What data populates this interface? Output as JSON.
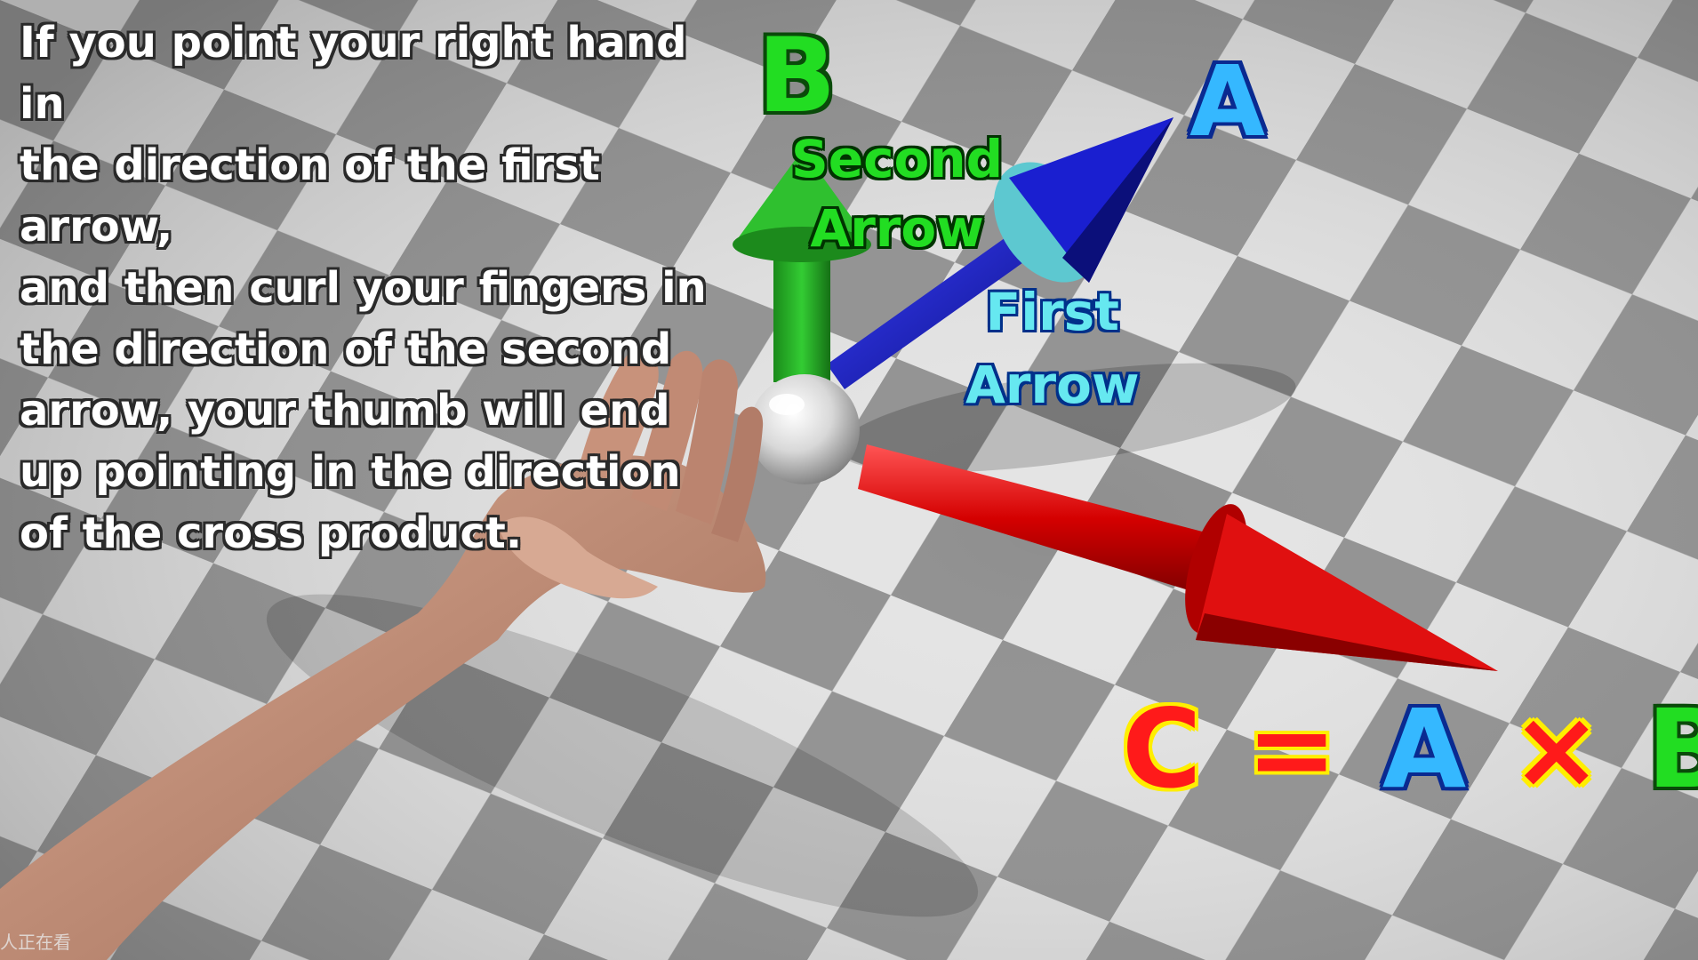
{
  "caption": {
    "lines": [
      "If you point your right hand in",
      "the direction of the first arrow,",
      "and then curl your fingers in",
      "the direction of the second",
      "arrow, your thumb will end",
      "up pointing in the direction",
      "of the cross product."
    ]
  },
  "labels": {
    "b_top": "B",
    "a_top": "A",
    "second_line1": "Second",
    "second_line2": "Arrow",
    "first_line1": "First",
    "first_line2": "Arrow"
  },
  "equation": {
    "c": "C",
    "equals": "=",
    "a": "A",
    "times": "×",
    "b": "B"
  },
  "watermark": "人正在看",
  "colors": {
    "arrow_a": "#1a1fd0",
    "arrow_b": "#22b022",
    "arrow_c": "#e01010",
    "floor_light": "#e6e6e6",
    "floor_dark": "#8f8f8f"
  }
}
